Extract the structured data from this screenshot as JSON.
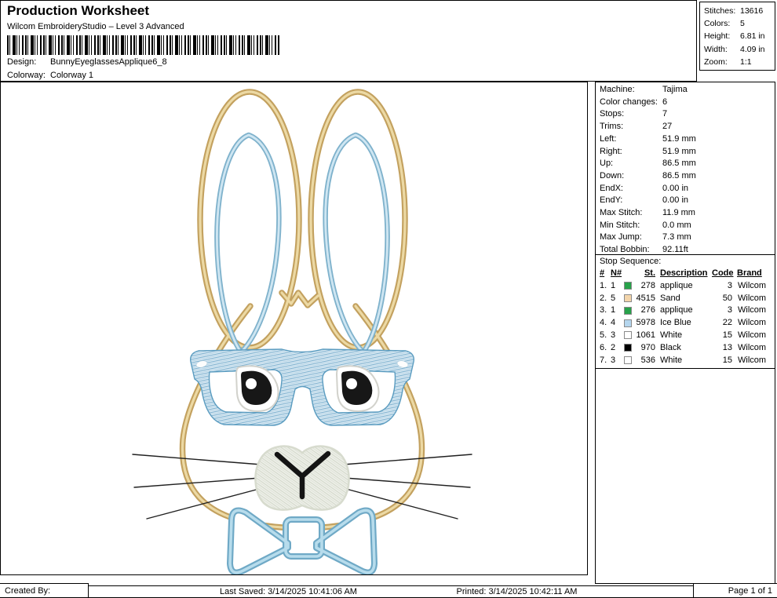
{
  "header": {
    "title": "Production Worksheet",
    "subtitle": "Wilcom EmbroideryStudio – Level 3 Advanced",
    "design_label": "Design:",
    "design_value": "BunnyEyeglassesApplique6_8",
    "colorway_label": "Colorway:",
    "colorway_value": "Colorway 1"
  },
  "stats": {
    "rows": [
      {
        "label": "Stitches:",
        "value": "13616"
      },
      {
        "label": "Colors:",
        "value": "5"
      },
      {
        "label": "Height:",
        "value": "6.81 in"
      },
      {
        "label": "Width:",
        "value": "4.09 in"
      },
      {
        "label": "Zoom:",
        "value": "1:1"
      }
    ]
  },
  "machine": {
    "rows": [
      {
        "label": "Machine:",
        "value": "Tajima"
      },
      {
        "label": "Color changes:",
        "value": "6"
      },
      {
        "label": "Stops:",
        "value": "7"
      },
      {
        "label": "Trims:",
        "value": "27"
      },
      {
        "label": "Left:",
        "value": "51.9 mm"
      },
      {
        "label": "Right:",
        "value": "51.9 mm"
      },
      {
        "label": "Up:",
        "value": "86.5 mm"
      },
      {
        "label": "Down:",
        "value": "86.5 mm"
      },
      {
        "label": "EndX:",
        "value": "0.00 in"
      },
      {
        "label": "EndY:",
        "value": "0.00 in"
      },
      {
        "label": "Max Stitch:",
        "value": "11.9 mm"
      },
      {
        "label": "Min Stitch:",
        "value": "0.0 mm"
      },
      {
        "label": "Max Jump:",
        "value": "7.3 mm"
      },
      {
        "label": "Total Bobbin:",
        "value": "92.11ft"
      }
    ]
  },
  "stop_sequence": {
    "title": "Stop Sequence:",
    "headers": {
      "num": "#",
      "n": "N#",
      "st": "St.",
      "description": "Description",
      "code": "Code",
      "brand": "Brand"
    },
    "rows": [
      {
        "num": "1.",
        "n": "1",
        "swatch": "#27a24a",
        "st": "278",
        "description": "applique",
        "code": "3",
        "brand": "Wilcom"
      },
      {
        "num": "2.",
        "n": "5",
        "swatch": "#f3d5ab",
        "st": "4515",
        "description": "Sand",
        "code": "50",
        "brand": "Wilcom"
      },
      {
        "num": "3.",
        "n": "1",
        "swatch": "#27a24a",
        "st": "276",
        "description": "applique",
        "code": "3",
        "brand": "Wilcom"
      },
      {
        "num": "4.",
        "n": "4",
        "swatch": "#b5d6ee",
        "st": "5978",
        "description": "Ice Blue",
        "code": "22",
        "brand": "Wilcom"
      },
      {
        "num": "5.",
        "n": "3",
        "swatch": "#ffffff",
        "st": "1061",
        "description": "White",
        "code": "15",
        "brand": "Wilcom"
      },
      {
        "num": "6.",
        "n": "2",
        "swatch": "#000000",
        "st": "970",
        "description": "Black",
        "code": "13",
        "brand": "Wilcom"
      },
      {
        "num": "7.",
        "n": "3",
        "swatch": "#ffffff",
        "st": "536",
        "description": "White",
        "code": "15",
        "brand": "Wilcom"
      }
    ]
  },
  "footer": {
    "created_by": "Created By:",
    "last_saved": "Last Saved: 3/14/2025 10:41:06 AM",
    "printed": "Printed: 3/14/2025 10:42:11 AM",
    "page": "Page 1 of 1"
  },
  "artwork": {
    "name": "bunny-with-eyeglasses-and-bow-tie-applique",
    "colors": {
      "sand_dark": "#c3a15f",
      "sand_light": "#ecd9a4",
      "blue_dark": "#7fb2cc",
      "blue_light": "#cfe6f2",
      "bow_dark": "#6fa9c6",
      "bow_light": "#b7dcec",
      "glasses_fill": "#e6f1f8",
      "glasses_line": "#5b9cc0",
      "eye_black": "#171717",
      "nose_fill": "#eef0e9",
      "whisker": "#202020"
    }
  }
}
